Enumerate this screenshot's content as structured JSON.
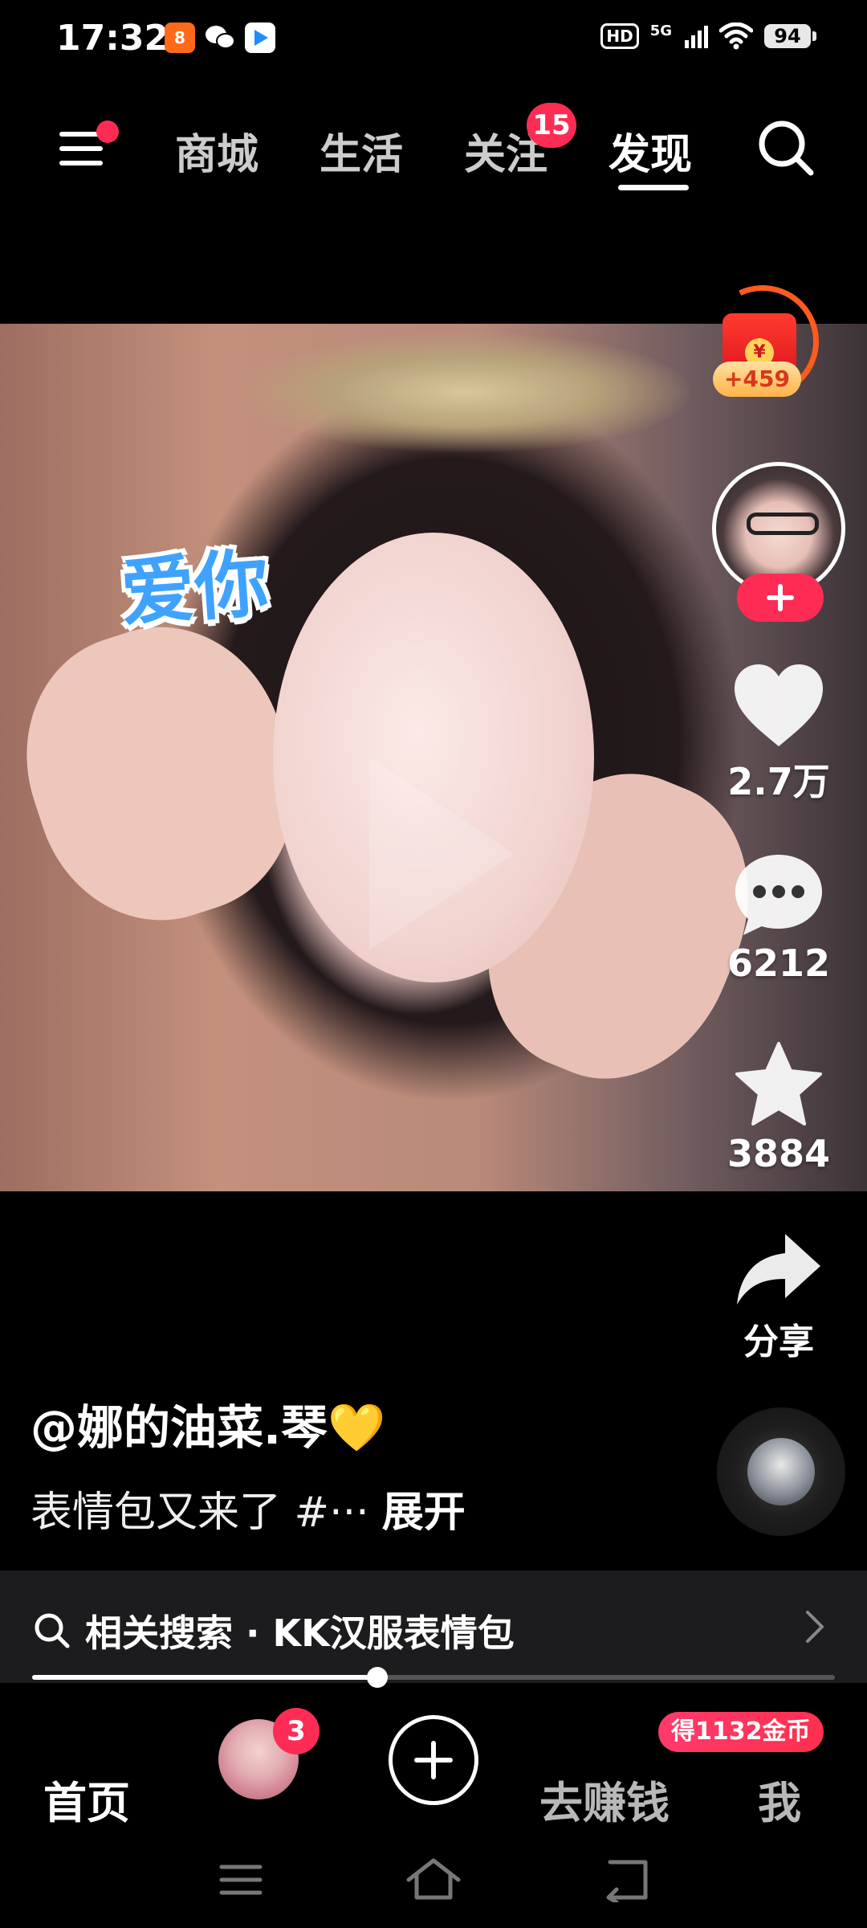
{
  "status_bar": {
    "time": "17:32",
    "network": "5G",
    "hd": "HD",
    "battery": "94",
    "apps": [
      {
        "name": "app-icon-orange",
        "color": "#ff6a1a",
        "glyph": "8"
      },
      {
        "name": "wechat-icon",
        "color": "#000000",
        "glyph": "✉"
      },
      {
        "name": "video-app-icon",
        "color": "#ffffff",
        "glyph": "▶"
      }
    ]
  },
  "top_nav": {
    "tabs": [
      "商城",
      "生活",
      "关注",
      "发现"
    ],
    "active_tab": "发现",
    "follow_badge": "15"
  },
  "video": {
    "sticker_text": "爱你"
  },
  "right_rail": {
    "red_packet_amount": "+459",
    "red_packet_coin": "¥",
    "likes": "2.7万",
    "comments": "6212",
    "favorites": "3884",
    "share_label": "分享"
  },
  "caption": {
    "author": "@娜的油菜.琴💛",
    "text": "表情包又来了 #···",
    "expand": "展开"
  },
  "related_search": {
    "label": "相关搜索 · KK汉服表情包"
  },
  "playback": {
    "progress": 0.43
  },
  "bottom_tabs": {
    "home": "首页",
    "friends_badge": "3",
    "earn": "去赚钱",
    "me": "我",
    "coin_badge": "得1132金币"
  },
  "colors": {
    "accent": "#fe2c55",
    "background": "#000000",
    "related_bar": "#1c1c1e"
  }
}
